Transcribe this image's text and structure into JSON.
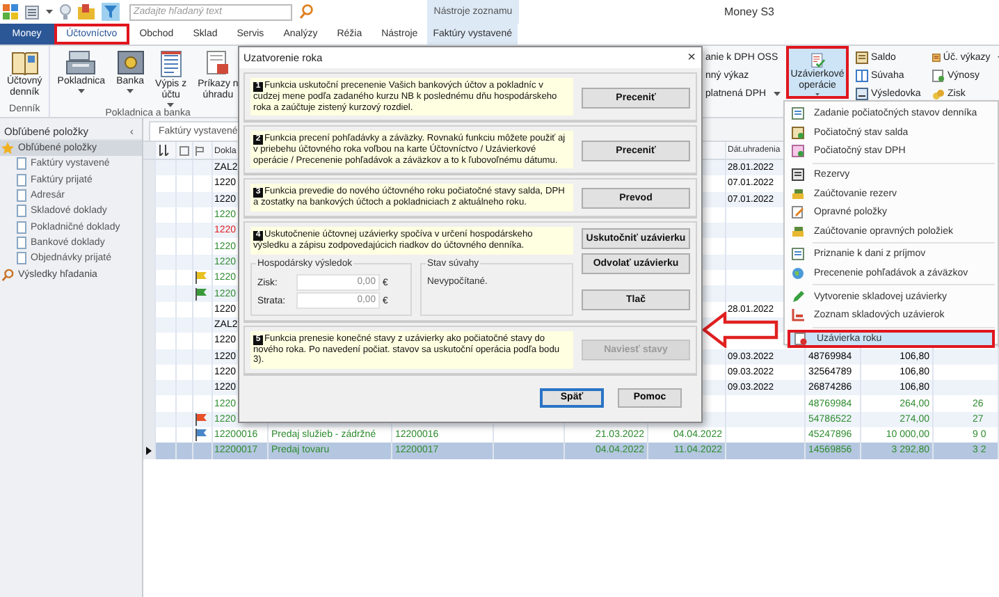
{
  "toolbar": {
    "search": {
      "placeholder": "Zadajte hľadaný text"
    }
  },
  "context_group": "Nástroje zoznamu",
  "title": "Money S3",
  "tabs": [
    {
      "label": "Money",
      "kind": "file",
      "selected": false,
      "highlighted": false
    },
    {
      "label": "Účtovníctvo",
      "kind": "tab",
      "selected": true,
      "highlighted": true
    },
    {
      "label": "Obchod",
      "kind": "tab",
      "selected": false,
      "highlighted": false
    },
    {
      "label": "Sklad",
      "kind": "tab",
      "selected": false,
      "highlighted": false
    },
    {
      "label": "Servis",
      "kind": "tab",
      "selected": false,
      "highlighted": false
    },
    {
      "label": "Analýzy",
      "kind": "tab",
      "selected": false,
      "highlighted": false
    },
    {
      "label": "Réžia",
      "kind": "tab",
      "selected": false,
      "highlighted": false
    },
    {
      "label": "Nástroje",
      "kind": "tab",
      "selected": false,
      "highlighted": false
    },
    {
      "label": "Faktúry vystavené",
      "kind": "context",
      "selected": false,
      "highlighted": false
    }
  ],
  "ribbon": {
    "groups": [
      {
        "label": "Denník",
        "buttons": [
          {
            "lines": [
              "Účtovný",
              "denník"
            ],
            "kind": "book",
            "dropdown": false
          }
        ]
      },
      {
        "label": "Pokladnica a banka",
        "buttons": [
          {
            "lines": [
              "Pokladnica"
            ],
            "kind": "register",
            "dropdown": true
          },
          {
            "lines": [
              "Banka"
            ],
            "kind": "safe",
            "dropdown": true
          },
          {
            "lines": [
              "Výpis z",
              "účtu"
            ],
            "kind": "statement",
            "dropdown": true
          },
          {
            "lines": [
              "Príkazy n",
              "úhradu"
            ],
            "kind": "order",
            "dropdown": false
          }
        ]
      }
    ],
    "partial_items": [
      {
        "label": "anie k DPH OSS"
      },
      {
        "label": "nný výkaz"
      },
      {
        "label": "platnená DPH",
        "dropdown": true
      }
    ],
    "closing_button": {
      "lines": [
        "Uzávierkové",
        "operácie"
      ],
      "dropdown": true,
      "pressed": true,
      "highlighted": true
    },
    "small_columns": [
      [
        {
          "label": "Saldo",
          "kind": "ledger",
          "dropdown": false
        },
        {
          "label": "Súvaha",
          "kind": "balance",
          "dropdown": false
        },
        {
          "label": "Výsledovka",
          "kind": "report",
          "dropdown": false
        }
      ],
      [
        {
          "label": "Úč. výkazy",
          "kind": "statements",
          "dropdown": true
        },
        {
          "label": "Výnosy",
          "kind": "revenue",
          "dropdown": false
        },
        {
          "label": "Zisk",
          "kind": "profit",
          "dropdown": false
        }
      ]
    ]
  },
  "sidebar": {
    "title": "Obľúbené položky",
    "collapse": "‹",
    "tree": [
      {
        "label": "Obľúbené položky",
        "kind": "favorites",
        "selected": true,
        "children": [
          {
            "label": "Faktúry vystavené",
            "kind": "document",
            "selected": false
          },
          {
            "label": "Faktúry prijaté",
            "kind": "document",
            "selected": false
          },
          {
            "label": "Adresár",
            "kind": "document",
            "selected": false
          },
          {
            "label": "Skladové doklady",
            "kind": "document",
            "selected": false
          },
          {
            "label": "Pokladničné doklady",
            "kind": "document",
            "selected": false
          },
          {
            "label": "Bankové doklady",
            "kind": "document",
            "selected": false
          },
          {
            "label": "Objednávky prijaté",
            "kind": "document",
            "selected": false
          }
        ]
      },
      {
        "label": "Výsledky hľadania",
        "kind": "search",
        "selected": false
      }
    ]
  },
  "document_tab": "Faktúry vystavené",
  "table": {
    "header": {
      "doklad": "Dokla",
      "dat_uhradenia": "Dát.uhradenia"
    },
    "rows": [
      {
        "doklad": "ZAL2",
        "color": "#000000",
        "dat_uhradenia": "28.01.2022",
        "selected": false
      },
      {
        "doklad": "1220",
        "color": "#000000",
        "dat_uhradenia": "07.01.2022",
        "selected": false
      },
      {
        "doklad": "1220",
        "color": "#000000",
        "dat_uhradenia": "07.01.2022",
        "selected": false
      },
      {
        "doklad": "1220",
        "color": "#2e8b2e",
        "selected": false
      },
      {
        "doklad": "1220",
        "color": "#e02020",
        "selected": false
      },
      {
        "doklad": "1220",
        "color": "#2e8b2e",
        "selected": false
      },
      {
        "doklad": "1220",
        "color": "#2e8b2e",
        "selected": false
      },
      {
        "doklad": "1220",
        "color": "#2e8b2e",
        "flag": {
          "color": "#e8c020"
        },
        "selected": false
      },
      {
        "doklad": "1220",
        "color": "#2e8b2e",
        "flag": {
          "color": "#3a9a3a"
        },
        "selected": false
      },
      {
        "doklad": "1220",
        "color": "#000000",
        "dat_uhradenia": "28.01.2022",
        "selected": false
      },
      {
        "doklad": "ZAL2",
        "color": "#000000",
        "selected": false
      },
      {
        "doklad": "1220",
        "color": "#000000",
        "selected": false
      },
      {
        "doklad": "1220",
        "color": "#000000",
        "dat_uhradenia": "09.03.2022",
        "column_11": "48769984",
        "column_12": "106,80",
        "selected": false
      },
      {
        "doklad": "1220",
        "color": "#000000",
        "dat_uhradenia": "09.03.2022",
        "column_11": "32564789",
        "column_12": "106,80",
        "selected": false
      },
      {
        "doklad": "1220",
        "color": "#000000",
        "dat_uhradenia": "09.03.2022",
        "column_11": "26874286",
        "column_12": "106,80",
        "selected": false
      },
      {
        "doklad": "1220",
        "color": "#2e8b2e",
        "column_11": "48769984",
        "column_12": "264,00",
        "column_13": "26",
        "selected": false
      },
      {
        "doklad": "1220",
        "color": "#2e8b2e",
        "flag": {
          "color": "#e8502a"
        },
        "column_11": "54786522",
        "column_12": "274,00",
        "column_13": "27",
        "selected": false
      },
      {
        "doklad": "12200016",
        "color": "#2e8b2e",
        "flag": {
          "color": "#4a86c8"
        },
        "column_6": "Predaj služieb - zádržné",
        "column_7": "12200016",
        "column_9": "21.03.2022",
        "column_10": "04.04.2022",
        "column_11": "45247896",
        "column_12": "10 000,00",
        "column_13": "9 0",
        "selected": false
      },
      {
        "doklad": "12200017",
        "color": "#2e8b2e",
        "column_6": "Predaj tovaru",
        "column_7": "12200017",
        "column_9": "04.04.2022",
        "column_10": "11.04.2022",
        "column_11": "14569856",
        "column_12": "3 292,80",
        "column_13": "3 2",
        "selected": true
      }
    ]
  },
  "menu": {
    "sections": [
      [
        {
          "label": "Zadanie počiatočných stavov denníka",
          "kind": "journal",
          "selected": false
        },
        {
          "label": "Počiatočný stav salda",
          "kind": "ledger",
          "selected": false
        },
        {
          "label": "Počiatočný stav DPH",
          "kind": "tax",
          "selected": false
        }
      ],
      [
        {
          "label": "Rezervy",
          "kind": "reserve",
          "selected": false
        },
        {
          "label": "Zaúčtovanie rezerv",
          "kind": "post",
          "selected": false
        },
        {
          "label": "Opravné položky",
          "kind": "edit",
          "selected": false
        },
        {
          "label": "Zaúčtovanie opravných položiek",
          "kind": "post",
          "selected": false
        }
      ],
      [
        {
          "label": "Priznanie k dani z príjmov",
          "kind": "journal",
          "selected": false
        },
        {
          "label": "Precenenie pohľadávok a záväzkov",
          "kind": "globe",
          "selected": false
        }
      ],
      [
        {
          "label": "Vytvorenie skladovej uzávierky",
          "kind": "pencil",
          "selected": false
        },
        {
          "label": "Zoznam skladových uzávierok",
          "kind": "chart",
          "selected": false
        }
      ],
      [
        {
          "label": "Uzávierka roku",
          "kind": "close",
          "selected": true
        }
      ]
    ]
  },
  "dialog": {
    "title": "Uzatvorenie roka",
    "close": "×",
    "sections": [
      {
        "kind": "simple",
        "number": "1",
        "text": "Funkcia uskutoční precenenie Vašich bankových účtov a pokladníc v cudzej mene podľa zadaného kurzu NB k poslednému dňu hospodárskeho roka a zaúčtuje zistený kurzový rozdiel.",
        "buttons": [
          {
            "label": "Preceniť",
            "disabled": false
          }
        ]
      },
      {
        "kind": "simple",
        "number": "2",
        "text": "Funkcia precení pohľadávky a záväzky. Rovnakú funkciu môžete použiť aj v priebehu účtovného roka voľbou na karte Účtovníctvo / Uzávierkové operácie / Precenenie pohľadávok a záväzkov a to k ľubovoľnému dátumu.",
        "buttons": [
          {
            "label": "Preceniť",
            "disabled": false
          }
        ]
      },
      {
        "kind": "simple",
        "number": "3",
        "text": "Funkcia prevedie do nového účtovného roku počiatočné stavy salda, DPH a zostatky na bankových účtoch a pokladniciach z aktuálneho roku.",
        "buttons": [
          {
            "label": "Prevod",
            "disabled": false
          }
        ]
      },
      {
        "kind": "closing",
        "number": "4",
        "text": "Uskutočnenie účtovnej uzávierky spočíva v určení hospodárskeho výsledku a zápisu zodpovedajúcich riadkov do účtovného denníka.",
        "buttons": [
          {
            "label": "Uskutočniť uzávierku",
            "disabled": false
          },
          {
            "label": "Odvolať uzávierku",
            "disabled": false
          },
          {
            "label": "Tlač",
            "disabled": false
          }
        ],
        "result": {
          "title": "Hospodársky výsledok",
          "fields": [
            {
              "label": "Zisk:",
              "value": "0,00",
              "unit": "€"
            },
            {
              "label": "Strata:",
              "value": "0,00",
              "unit": "€"
            }
          ]
        },
        "balance": {
          "title": "Stav súvahy",
          "text": "Nevypočítané."
        }
      },
      {
        "kind": "simple",
        "number": "5",
        "text": "Funkcia prenesie konečné stavy z uzávierky ako počiatočné stavy do nového roka. Po navedení počiat. stavov sa uskutoční operácia podľa bodu 3).",
        "buttons": [
          {
            "label": "Naviesť stavy",
            "disabled": true
          }
        ]
      }
    ],
    "footer_buttons": [
      {
        "label": "Späť",
        "default": true
      },
      {
        "label": "Pomoc",
        "default": false
      }
    ]
  }
}
